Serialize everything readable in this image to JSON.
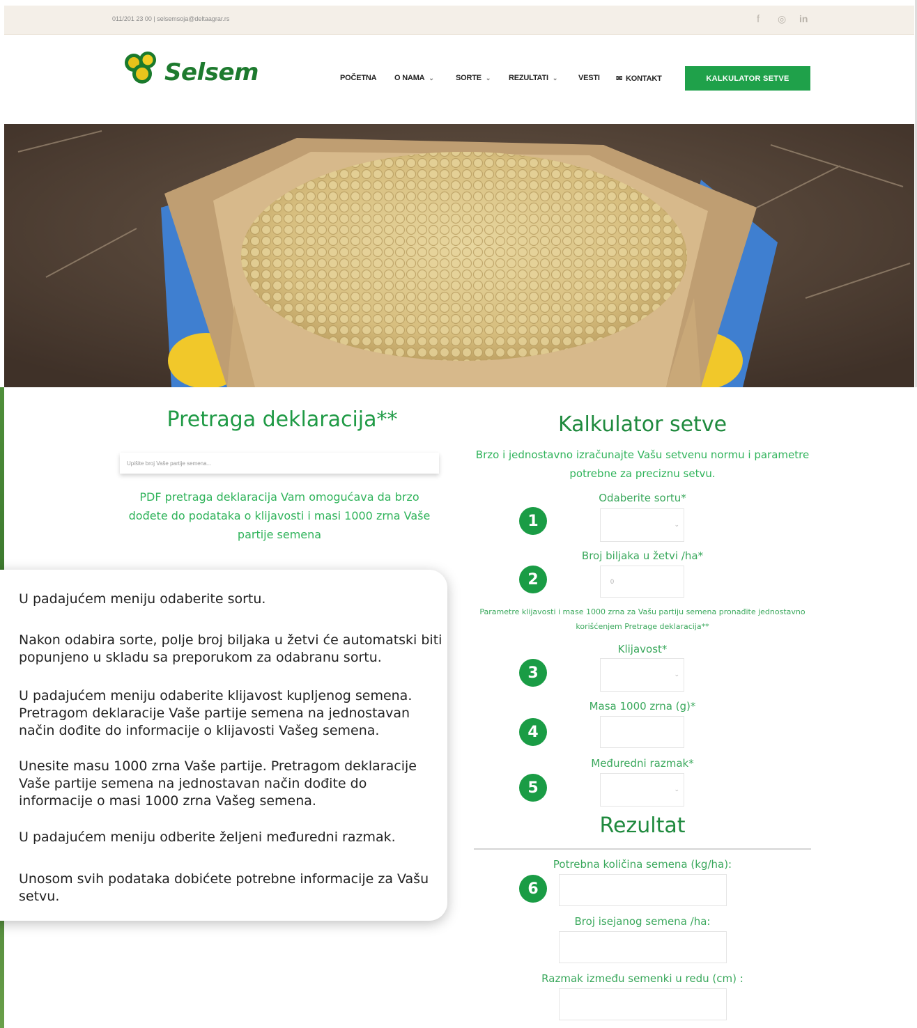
{
  "topbar": {
    "contact": "011/201 23 00 | selsemsoja@deltaagrar.rs",
    "social": [
      "f",
      "◎",
      "in"
    ]
  },
  "header": {
    "logo_text": "Selsem",
    "nav": [
      {
        "label": "POČETNA",
        "dropdown": false
      },
      {
        "label": "O NAMA",
        "dropdown": true
      },
      {
        "label": "SORTE",
        "dropdown": true
      },
      {
        "label": "REZULTATI",
        "dropdown": true
      },
      {
        "label": "VESTI",
        "dropdown": false
      },
      {
        "label": "KONTAKT",
        "dropdown": false
      }
    ],
    "cta_label": "KALKULATOR SETVE"
  },
  "left": {
    "title": "Pretraga deklaracija**",
    "search_placeholder": "Upišite broj Vaše partije semena...",
    "description": "PDF pretraga deklaracija Vam omogućava da brzo dođete do podataka o klijavosti i masi 1000 zrna Vaše partije semena"
  },
  "calc": {
    "title": "Kalkulator setve",
    "subtitle": "Brzo i jednostavno izračunajte Vašu setvenu normu i parametre potrebne za preciznu setvu.",
    "fields": {
      "sorta": "Odaberite sortu*",
      "biljke": "Broj biljaka u žetvi /ha*",
      "biljke_value": "0",
      "klijavost": "Klijavost*",
      "masa": "Masa 1000 zrna (g)*",
      "razmak": "Međuredni razmak*"
    },
    "note": "Parametre klijavosti i mase 1000 zrna za Vašu partiju semena pronađite jednostavno korišćenjem Pretrage deklaracija**",
    "badges": [
      "1",
      "2",
      "3",
      "4",
      "5",
      "6"
    ]
  },
  "result": {
    "title": "Rezultat",
    "kolicina": "Potrebna količina semena (kg/ha):",
    "broj": "Broj isejanog semena /ha:",
    "razmak": "Razmak između semenki u redu (cm) :"
  },
  "instructions": [
    "U padajućem meniju odaberite sortu.",
    "Nakon odabira sorte, polje broj biljaka u žetvi će automatski biti popunjeno u skladu sa preporukom za odabranu sortu.",
    "U padajućem meniju odaberite klijavost kupljenog semena. Pretragom deklaracije Vaše partije semena na jednostavan način dođite do informacije o klijavosti Vašeg semena.",
    "Unesite masu 1000 zrna Vaše partije. Pretragom deklaracije Vaše partije semena na jednostavan način dođite do informacije o masi 1000 zrna Vašeg semena.",
    "U padajućem meniju odberite željeni međuredni razmak.",
    "Unosom svih podataka dobićete potrebne informacije za Vašu setvu."
  ],
  "colors": {
    "brand_green": "#1fa14a",
    "text_green": "#2fb35a",
    "topbar_bg": "#f4efe8"
  }
}
